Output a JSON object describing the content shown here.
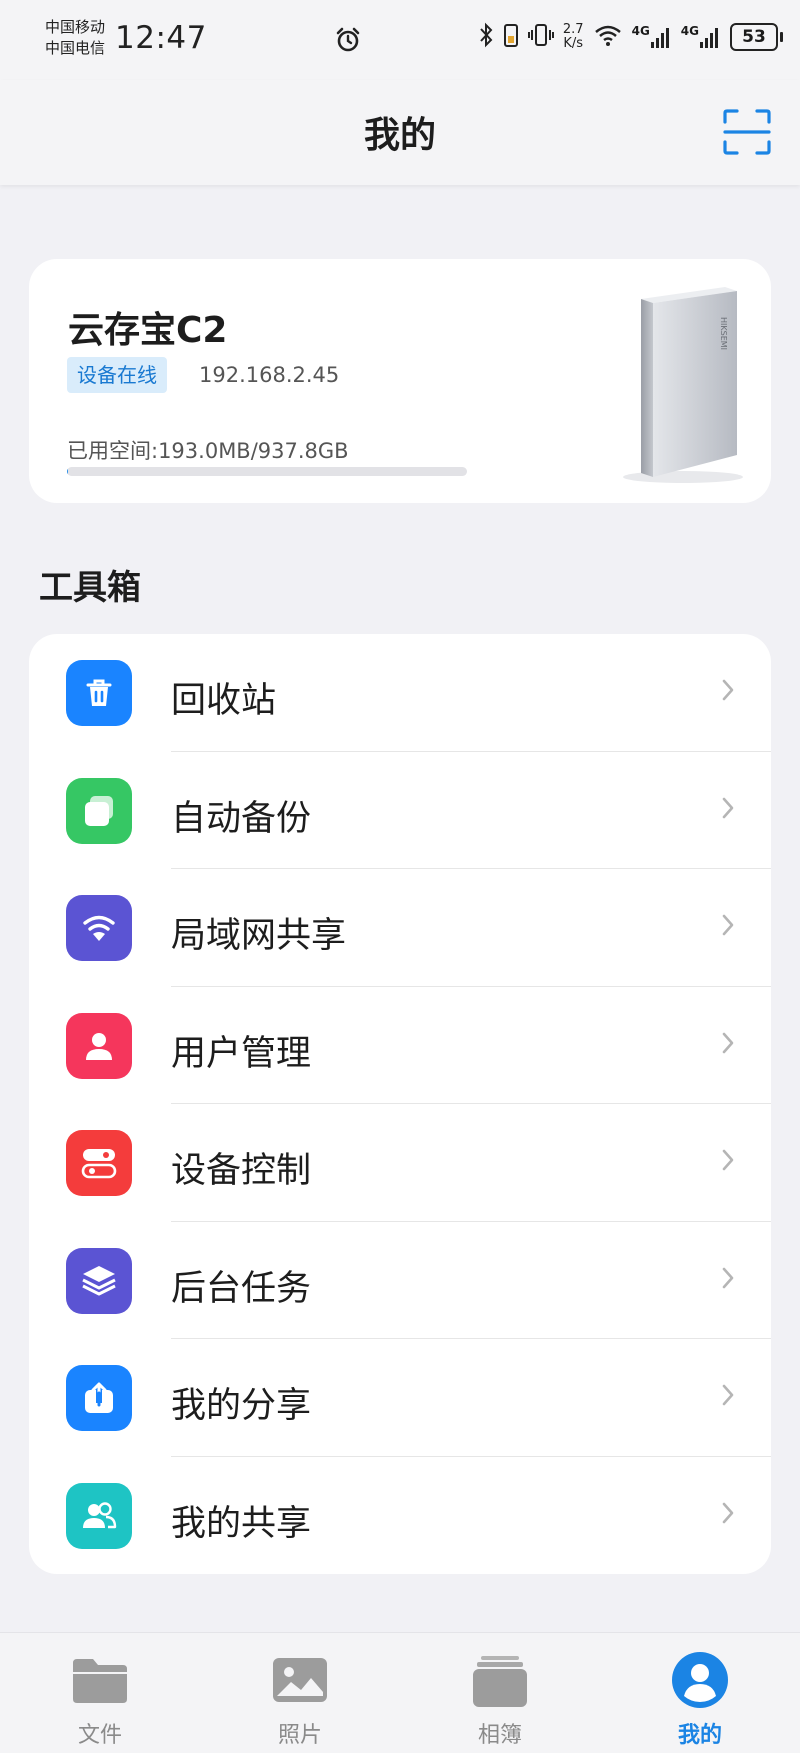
{
  "status_bar": {
    "carrier_1": "中国移动",
    "carrier_2": "中国电信",
    "time": "12:47",
    "speed_value": "2.7",
    "speed_unit": "K/s",
    "network_1": "4G",
    "network_2": "4G",
    "battery": "53"
  },
  "header": {
    "title": "我的",
    "scan_icon": "scan-icon"
  },
  "device": {
    "name": "云存宝C2",
    "status": "设备在线",
    "ip": "192.168.2.45",
    "storage_text": "已用空间:193.0MB/937.8GB",
    "storage_used_fraction": 0.0002,
    "image_brand": "HIKSEMI"
  },
  "toolbox": {
    "title": "工具箱",
    "items": [
      {
        "label": "回收站",
        "icon": "trash-icon",
        "color": "#1a84ff"
      },
      {
        "label": "自动备份",
        "icon": "backup-icon",
        "color": "#36c764"
      },
      {
        "label": "局域网共享",
        "icon": "wifi-icon",
        "color": "#5b54d3"
      },
      {
        "label": "用户管理",
        "icon": "user-icon",
        "color": "#f5365c"
      },
      {
        "label": "设备控制",
        "icon": "toggle-icon",
        "color": "#f43c3c"
      },
      {
        "label": "后台任务",
        "icon": "layers-icon",
        "color": "#5b54d3"
      },
      {
        "label": "我的分享",
        "icon": "share-upload-icon",
        "color": "#1a84ff"
      },
      {
        "label": "我的共享",
        "icon": "group-icon",
        "color": "#1ec4c4"
      }
    ]
  },
  "bottom_nav": {
    "items": [
      {
        "label": "文件",
        "icon": "folder-icon"
      },
      {
        "label": "照片",
        "icon": "photo-icon"
      },
      {
        "label": "相簿",
        "icon": "album-icon"
      },
      {
        "label": "我的",
        "icon": "profile-icon",
        "active": true
      }
    ]
  },
  "colors": {
    "accent": "#1b84e4",
    "background": "#f1f1f5",
    "card": "#ffffff",
    "badge_bg": "#d9ecfb"
  }
}
